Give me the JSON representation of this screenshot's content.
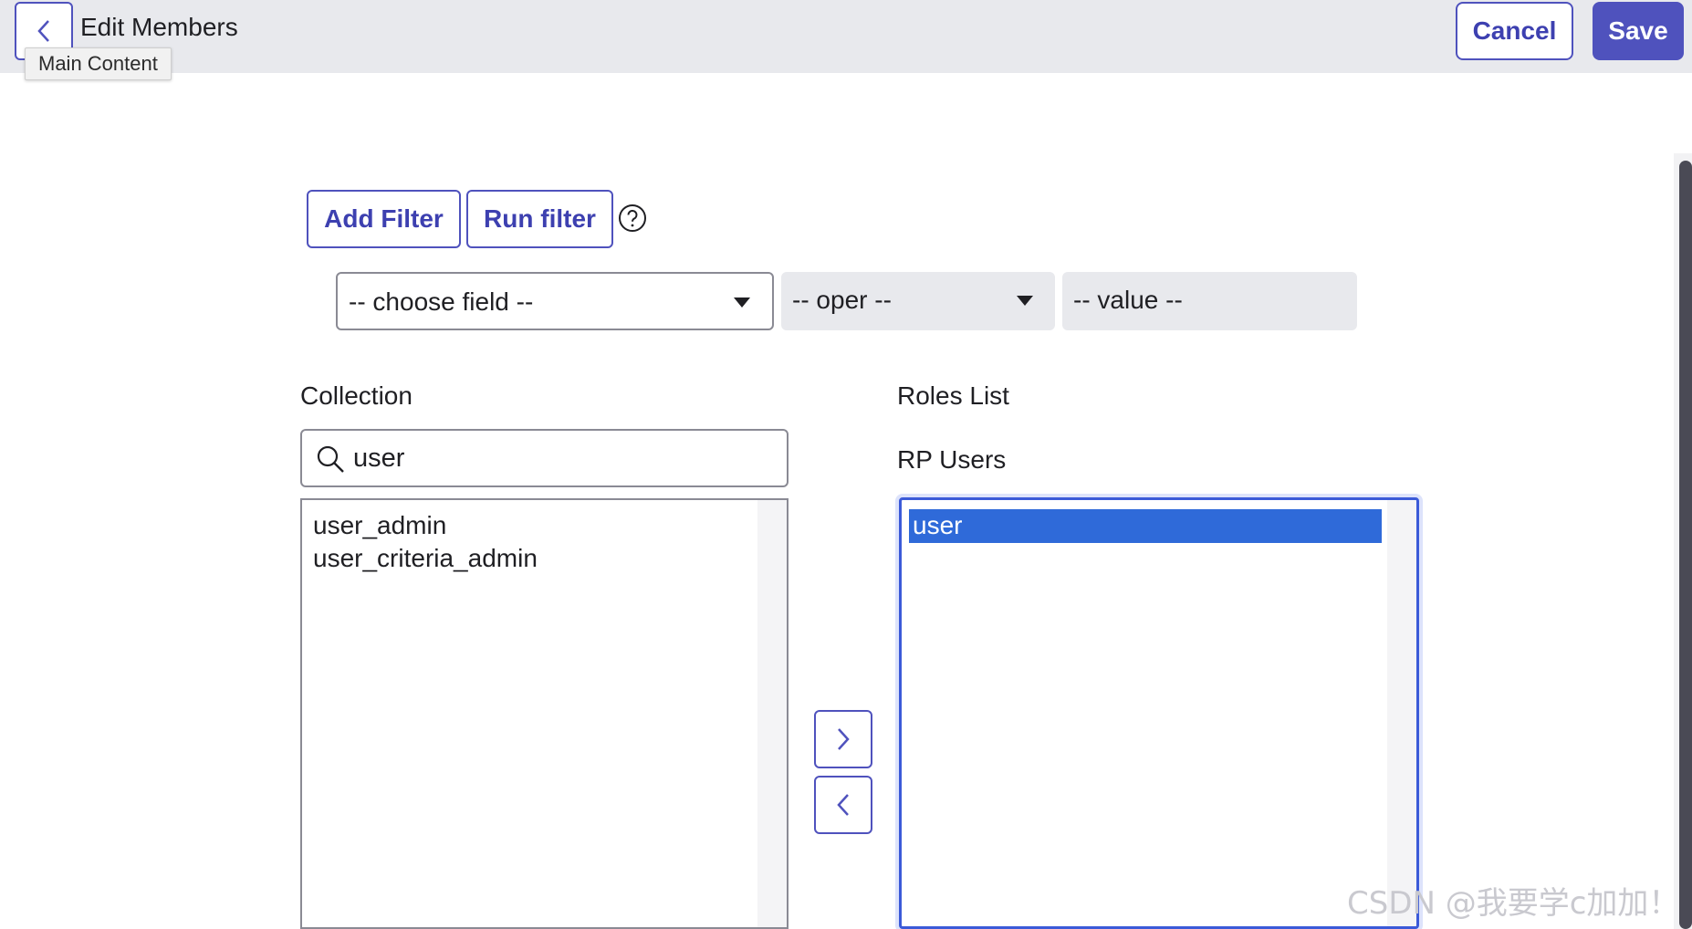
{
  "header": {
    "title": "Edit Members",
    "tooltip": "Main Content",
    "cancel_label": "Cancel",
    "save_label": "Save"
  },
  "filter": {
    "add_filter_label": "Add Filter",
    "run_filter_label": "Run filter",
    "field_placeholder": "-- choose field --",
    "oper_placeholder": "-- oper --",
    "value_placeholder": "-- value --"
  },
  "collection": {
    "label": "Collection",
    "search_value": "user",
    "items": [
      "user_admin",
      "user_criteria_admin"
    ]
  },
  "roles": {
    "label": "Roles List",
    "group_label": "RP Users",
    "items": [
      "user"
    ]
  },
  "watermark": "CSDN @我要学c加加！",
  "colors": {
    "accent": "#4f52bd",
    "header_bg": "#e8e9ed",
    "selection": "#2f6ad9"
  },
  "icons": [
    "back-chevron-icon",
    "help-circle-icon",
    "search-icon",
    "chevron-right-icon",
    "chevron-left-icon",
    "caret-down-icon"
  ]
}
